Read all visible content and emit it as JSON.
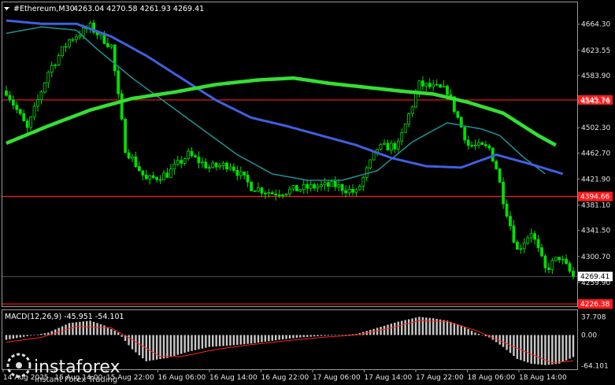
{
  "header": {
    "symbol": "#Ethereum,M30",
    "ohlc": "4263.04 4270.58 4261.93 4269.41",
    "macd_label": "MACD(12,26,9) -45.951 -54.101"
  },
  "watermark": {
    "brand": "instaforex",
    "tagline": "Instant Forex Trading"
  },
  "colors": {
    "background": "#000000",
    "candle": "#00e000",
    "ma_fast": "#1e8c8c",
    "ma_mid": "#4060e0",
    "ma_slow": "#33e033",
    "level": "#ff1a1a",
    "macd_hist": "#c8c8c8",
    "macd_signal": "#ff2020",
    "text": "#e6e6e6"
  },
  "chart_data": {
    "type": "candlestick",
    "timeframe": "M30",
    "price_axis": {
      "min": 4224,
      "max": 4680,
      "ticks": [
        "4664.30",
        "4623.55",
        "4583.90",
        "4543.70",
        "4502.30",
        "4462.70",
        "4421.90",
        "4381.10",
        "4341.50",
        "4300.70",
        "4259.90"
      ]
    },
    "time_labels": [
      "14 Aug 2025",
      "15 Aug 14:00",
      "15 Aug 22:00",
      "16 Aug 06:00",
      "16 Aug 14:00",
      "16 Aug 22:00",
      "17 Aug 06:00",
      "17 Aug 14:00",
      "17 Aug 22:00",
      "18 Aug 06:00",
      "18 Aug 14:00"
    ],
    "current_price": "4269.41",
    "levels": [
      {
        "price": 4545.74,
        "label": "4545.74"
      },
      {
        "price": 4394.66,
        "label": "4394.66"
      },
      {
        "price": 4226.38,
        "label": "4226.38"
      }
    ],
    "close_path": [
      [
        0,
        4560
      ],
      [
        6,
        4500
      ],
      [
        12,
        4590
      ],
      [
        18,
        4640
      ],
      [
        24,
        4660
      ],
      [
        30,
        4630
      ],
      [
        34,
        4470
      ],
      [
        40,
        4420
      ],
      [
        46,
        4430
      ],
      [
        52,
        4460
      ],
      [
        58,
        4440
      ],
      [
        64,
        4445
      ],
      [
        70,
        4410
      ],
      [
        76,
        4400
      ],
      [
        82,
        4405
      ],
      [
        88,
        4410
      ],
      [
        94,
        4412
      ],
      [
        100,
        4400
      ],
      [
        106,
        4470
      ],
      [
        112,
        4475
      ],
      [
        118,
        4570
      ],
      [
        122,
        4565
      ],
      [
        126,
        4560
      ],
      [
        132,
        4475
      ],
      [
        138,
        4470
      ],
      [
        140,
        4440
      ],
      [
        142,
        4390
      ],
      [
        146,
        4310
      ],
      [
        150,
        4340
      ],
      [
        154,
        4280
      ],
      [
        158,
        4300
      ],
      [
        162,
        4269
      ]
    ],
    "ma_fast_path": [
      [
        0,
        4650
      ],
      [
        10,
        4660
      ],
      [
        20,
        4655
      ],
      [
        26,
        4625
      ],
      [
        36,
        4580
      ],
      [
        46,
        4540
      ],
      [
        56,
        4500
      ],
      [
        66,
        4460
      ],
      [
        76,
        4430
      ],
      [
        86,
        4420
      ],
      [
        96,
        4420
      ],
      [
        106,
        4435
      ],
      [
        116,
        4480
      ],
      [
        126,
        4510
      ],
      [
        136,
        4500
      ],
      [
        141,
        4490
      ],
      [
        148,
        4455
      ],
      [
        154,
        4430
      ]
    ],
    "ma_mid_path": [
      [
        0,
        4670
      ],
      [
        10,
        4665
      ],
      [
        20,
        4665
      ],
      [
        30,
        4645
      ],
      [
        40,
        4615
      ],
      [
        50,
        4580
      ],
      [
        60,
        4545
      ],
      [
        70,
        4518
      ],
      [
        80,
        4505
      ],
      [
        90,
        4490
      ],
      [
        100,
        4475
      ],
      [
        110,
        4455
      ],
      [
        120,
        4442
      ],
      [
        130,
        4440
      ],
      [
        140,
        4460
      ],
      [
        150,
        4445
      ],
      [
        159,
        4430
      ]
    ],
    "ma_slow_path": [
      [
        0,
        4478
      ],
      [
        12,
        4505
      ],
      [
        24,
        4530
      ],
      [
        36,
        4548
      ],
      [
        48,
        4558
      ],
      [
        60,
        4570
      ],
      [
        72,
        4577
      ],
      [
        82,
        4580
      ],
      [
        92,
        4572
      ],
      [
        102,
        4566
      ],
      [
        112,
        4560
      ],
      [
        122,
        4555
      ],
      [
        132,
        4542
      ],
      [
        142,
        4525
      ],
      [
        152,
        4490
      ],
      [
        157,
        4475
      ]
    ],
    "macd": {
      "label": "MACD(12,26,9)",
      "macd_value": -45.951,
      "signal_value": -54.101,
      "axis_ticks": [
        "37.708",
        "0.00",
        "-64.101"
      ],
      "range": [
        -70,
        42
      ],
      "hist_path": [
        [
          0,
          -10
        ],
        [
          12,
          5
        ],
        [
          18,
          25
        ],
        [
          24,
          30
        ],
        [
          28,
          20
        ],
        [
          32,
          5
        ],
        [
          36,
          -30
        ],
        [
          40,
          -55
        ],
        [
          46,
          -48
        ],
        [
          52,
          -35
        ],
        [
          58,
          -25
        ],
        [
          64,
          -22
        ],
        [
          70,
          -18
        ],
        [
          78,
          -10
        ],
        [
          84,
          -5
        ],
        [
          90,
          -2
        ],
        [
          96,
          0
        ],
        [
          100,
          2
        ],
        [
          106,
          15
        ],
        [
          112,
          28
        ],
        [
          118,
          38
        ],
        [
          122,
          35
        ],
        [
          126,
          30
        ],
        [
          130,
          20
        ],
        [
          134,
          5
        ],
        [
          138,
          -5
        ],
        [
          142,
          -25
        ],
        [
          146,
          -50
        ],
        [
          150,
          -60
        ],
        [
          154,
          -63
        ],
        [
          158,
          -60
        ],
        [
          162,
          -46
        ]
      ],
      "signal_path": [
        [
          0,
          -15
        ],
        [
          10,
          -5
        ],
        [
          20,
          18
        ],
        [
          30,
          15
        ],
        [
          36,
          -10
        ],
        [
          44,
          -45
        ],
        [
          50,
          -45
        ],
        [
          60,
          -30
        ],
        [
          70,
          -20
        ],
        [
          80,
          -12
        ],
        [
          90,
          -5
        ],
        [
          100,
          0
        ],
        [
          110,
          15
        ],
        [
          118,
          30
        ],
        [
          126,
          28
        ],
        [
          134,
          10
        ],
        [
          142,
          -15
        ],
        [
          150,
          -40
        ],
        [
          156,
          -58
        ],
        [
          162,
          -54
        ]
      ]
    }
  }
}
